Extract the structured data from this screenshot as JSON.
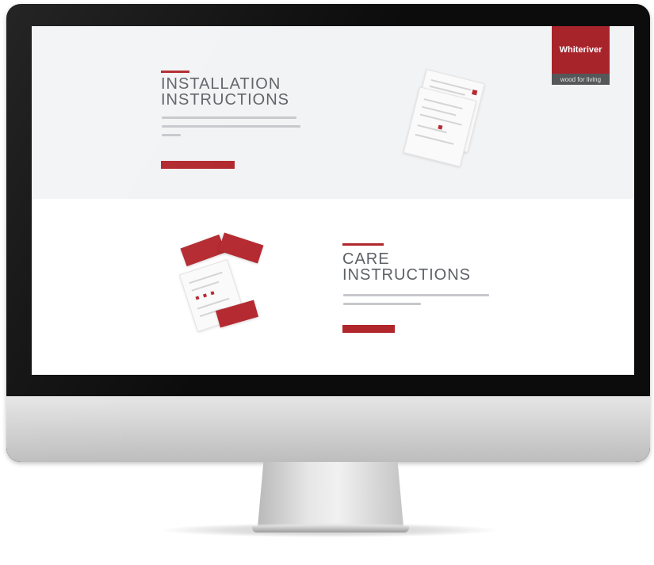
{
  "brand": {
    "name": "Whiteriver",
    "tagline": "wood for living",
    "accent_color": "#b0262b"
  },
  "installation": {
    "title_line1": "INSTALLATION",
    "title_line2": "INSTRUCTIONS",
    "button_color": "#b0262b",
    "image": "installation-instructions-sheets"
  },
  "care": {
    "title_line1": "CARE",
    "title_line2": "INSTRUCTIONS",
    "button_color": "#b0262b",
    "image": "care-instructions-cards"
  }
}
